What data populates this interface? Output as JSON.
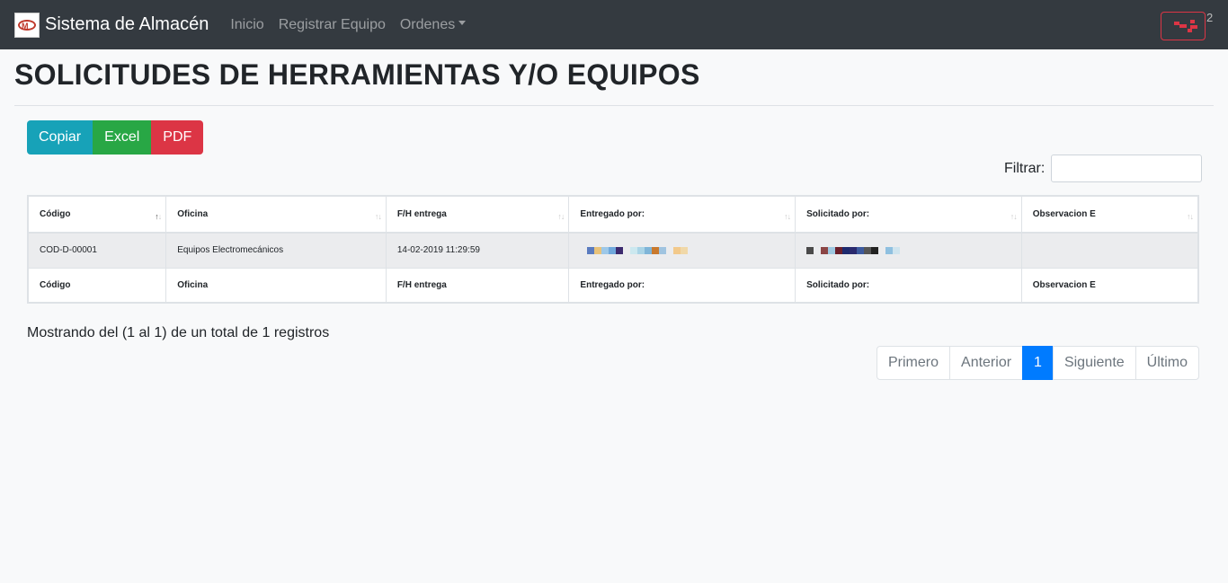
{
  "navbar": {
    "brand": "Sistema de Almacén",
    "links": [
      "Inicio",
      "Registrar Equipo",
      "Ordenes"
    ],
    "user_suffix": "2",
    "accent_color": "#dc3545"
  },
  "page": {
    "title": "SOLICITUDES DE HERRAMIENTAS Y/O EQUIPOS"
  },
  "export_buttons": {
    "copy": "Copiar",
    "excel": "Excel",
    "pdf": "PDF",
    "colors": {
      "copy": "#17a2b8",
      "excel": "#28a745",
      "pdf": "#dc3545"
    }
  },
  "filter": {
    "label": "Filtrar:",
    "value": ""
  },
  "table": {
    "columns": [
      "Código",
      "Oficina",
      "F/H entrega",
      "Entregado por:",
      "Solicitado por:",
      "Observacion E"
    ],
    "rows": [
      {
        "codigo": "COD-D-00001",
        "oficina": "Equipos Electromecánicos",
        "fecha": "14-02-2019 11:29:59",
        "entregado_por": "",
        "solicitado_por": "",
        "observacion": ""
      }
    ],
    "footer": [
      "Código",
      "Oficina",
      "F/H entrega",
      "Entregado por:",
      "Solicitado por:",
      "Observacion E"
    ]
  },
  "info_text": "Mostrando del (1 al 1) de un total de 1 registros",
  "pagination": {
    "first": "Primero",
    "prev": "Anterior",
    "current": "1",
    "next": "Siguiente",
    "last": "Último",
    "active_color": "#007bff"
  }
}
